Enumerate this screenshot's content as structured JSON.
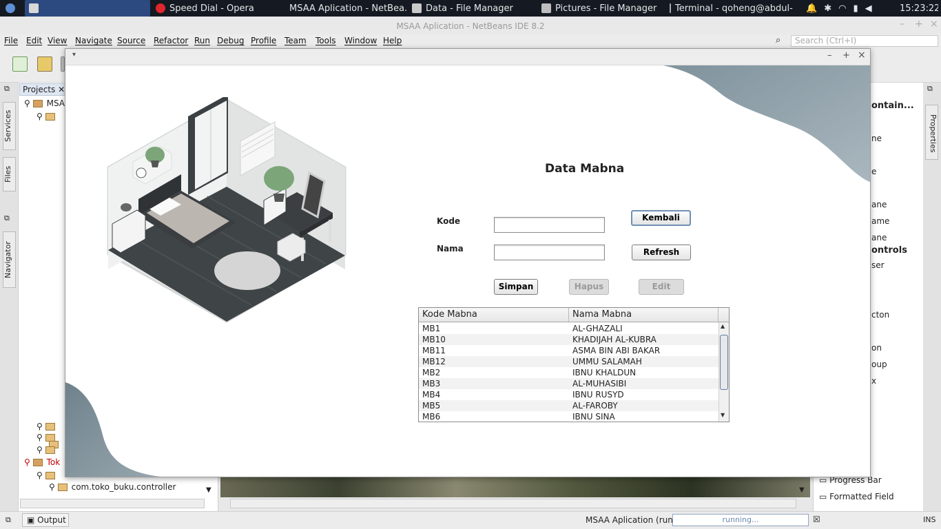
{
  "taskbar": {
    "tasks": [
      {
        "label": "Speed Dial - Opera"
      },
      {
        "label": "MSAA Aplication - NetBea..."
      },
      {
        "label": "Data - File Manager"
      },
      {
        "label": "Pictures - File Manager"
      },
      {
        "label": "Terminal - qoheng@abdul-..."
      }
    ],
    "clock": "15:23:22"
  },
  "ide": {
    "title": "MSAA Aplication - NetBeans IDE 8.2",
    "menu": [
      "File",
      "Edit",
      "View",
      "Navigate",
      "Source",
      "Refactor",
      "Run",
      "Debug",
      "Profile",
      "Team",
      "Tools",
      "Window",
      "Help"
    ],
    "search_placeholder": "Search (Ctrl+I)",
    "left_tabs": {
      "services": "Services",
      "files": "Files",
      "navigator": "Navigator"
    },
    "projects_tab": "Projects",
    "tree": {
      "root_msaa": "MSA",
      "root_toko": "Tok",
      "controller_pkg": "com.toko_buku.controller"
    },
    "right_panel": {
      "header": "ontain...",
      "items": [
        "ne",
        "e",
        "ane",
        "ame",
        "ane",
        "ontrols",
        "ser",
        "cton",
        "on",
        "oup",
        "x",
        "Progress Bar",
        "Formatted Field"
      ]
    },
    "right_tab": "Properties",
    "status": {
      "output": "Output",
      "run_label": "MSAA Aplication (run)",
      "progress": "running...",
      "ins": "INS"
    }
  },
  "app": {
    "heading": "Data Mabna",
    "form": {
      "kode_label": "Kode",
      "nama_label": "Nama",
      "kode_value": "",
      "nama_value": ""
    },
    "buttons": {
      "kembali": "Kembali",
      "refresh": "Refresh",
      "simpan": "Simpan",
      "hapus": "Hapus",
      "edit": "Edit"
    },
    "table": {
      "columns": [
        "Kode Mabna",
        "Nama Mabna"
      ],
      "rows": [
        [
          "MB1",
          "AL-GHAZALI"
        ],
        [
          "MB10",
          "KHADIJAH AL-KUBRA"
        ],
        [
          "MB11",
          "ASMA BIN ABI BAKAR"
        ],
        [
          "MB12",
          "UMMU SALAMAH"
        ],
        [
          "MB2",
          "IBNU KHALDUN"
        ],
        [
          "MB3",
          "AL-MUHASIBI"
        ],
        [
          "MB4",
          "IBNU RUSYD"
        ],
        [
          "MB5",
          "AL-FAROBY"
        ],
        [
          "MB6",
          "IBNU SINA"
        ]
      ]
    }
  }
}
